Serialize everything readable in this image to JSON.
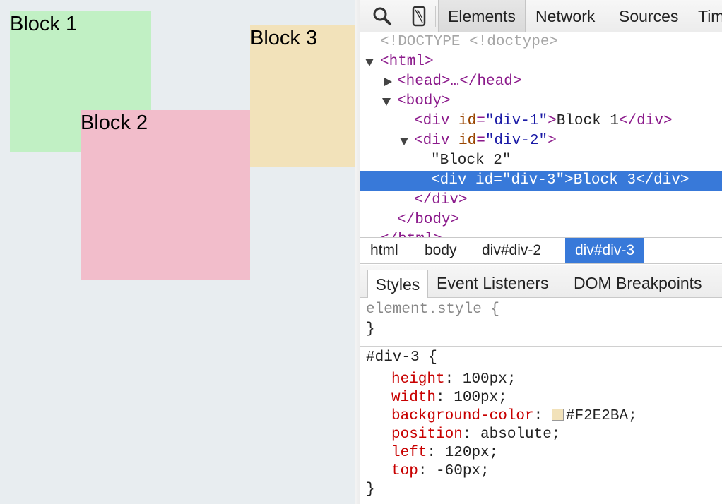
{
  "viewport": {
    "blocks": [
      {
        "label": "Block 1",
        "color": "#C1F0C4"
      },
      {
        "label": "Block 2",
        "color": "#F2BDCB"
      },
      {
        "label": "Block 3",
        "color": "#F2E2BA"
      }
    ]
  },
  "toolbar": {
    "icons": [
      "search-icon",
      "device-mode-icon"
    ],
    "tabs": [
      "Elements",
      "Network",
      "Sources",
      "Timeline"
    ]
  },
  "dom_tree": {
    "doctype": "<!DOCTYPE <!doctype>",
    "html_open": "<html>",
    "head": "<head>…</head>",
    "body_open": "<body>",
    "div1": {
      "tag": "div",
      "attr": "id",
      "value": "div-1",
      "text": "Block 1"
    },
    "div2": {
      "tag": "div",
      "attr": "id",
      "value": "div-2"
    },
    "div2_text": "\"Block 2\"",
    "div3": {
      "tag": "div",
      "attr": "id",
      "value": "div-3",
      "text": "Block 3"
    },
    "div_close": "</div>",
    "body_close": "</body>",
    "html_close": "</html>"
  },
  "breadcrumbs": [
    "html",
    "body",
    "div#div-2",
    "div#div-3"
  ],
  "styles_tabs": [
    "Styles",
    "Event Listeners",
    "DOM Breakpoints"
  ],
  "styles": {
    "element_style_selector": "element.style {",
    "close_brace": "}",
    "rule_selector": "#div-3 {",
    "properties": [
      {
        "name": "height",
        "value": "100px;"
      },
      {
        "name": "width",
        "value": "100px;"
      },
      {
        "name": "background-color",
        "value": "#F2E2BA;",
        "swatch": "#F2E2BA"
      },
      {
        "name": "position",
        "value": "absolute;"
      },
      {
        "name": "left",
        "value": "120px;"
      },
      {
        "name": "top",
        "value": "-60px;"
      }
    ]
  },
  "colors": {
    "selection": "#3879D9",
    "tag": "#8B1A8B",
    "attr": "#994500",
    "attr_value": "#1A1AA6",
    "css_property": "#C80000"
  }
}
